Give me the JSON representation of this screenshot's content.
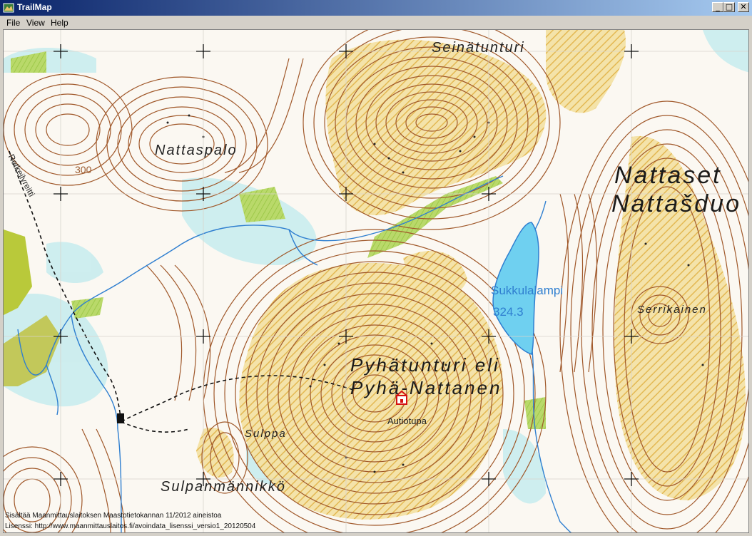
{
  "window": {
    "title": "TrailMap"
  },
  "window_controls": {
    "minimize": "_",
    "maximize": "□",
    "close": "✕"
  },
  "menu": {
    "items": [
      "File",
      "View",
      "Help"
    ]
  },
  "map": {
    "labels": {
      "nattaset": "Nattaset",
      "nattasduo": "Nattašduo",
      "seinatunturi": "Seinätunturi",
      "nattaspalo": "Nattaspalo",
      "sukkulalampi": "Sukkulalampi",
      "sukkulalampi_elevation": "324.3",
      "serrikainen": "Serrikainen",
      "pyhatunturi": "Pyhätunturi eli",
      "pyha_nattanen": "Pyhä-Nattanen",
      "autiotupa": "Autiotupa",
      "sulppa": "Sulppa",
      "sulpanmannikko": "Sulpanmännikkö",
      "retkeilyreitti": "Retkeilyreitti",
      "contour_300": "300"
    },
    "attribution": {
      "line1": "Sisältää Maanmittauslaitoksen Maastotietokannan 11/2012 aineistoa",
      "line2": "Lisenssi: http://www.maanmittauslaitos.fi/avoindata_lisenssi_versio1_20120504"
    },
    "colors": {
      "contour": "#a0582a",
      "water": "#6fd0f0",
      "stream": "#2f7fd0",
      "marsh": "#bfe6ea",
      "meadow": "#9ec94a",
      "rocky": "#e9c46a",
      "trail": "#111111",
      "background": "#fbf8f2"
    }
  }
}
